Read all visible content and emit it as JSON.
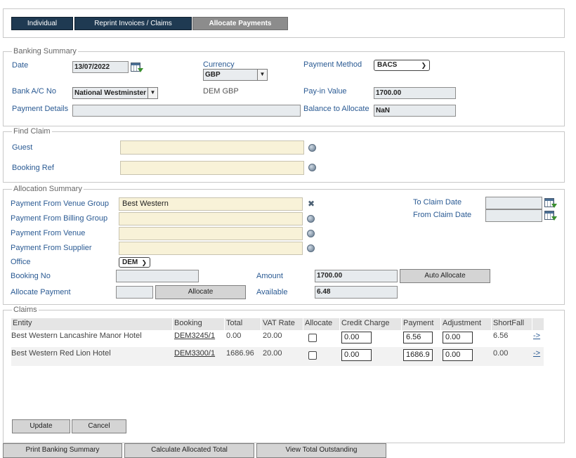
{
  "tabs": [
    {
      "label": "Individual"
    },
    {
      "label": "Reprint Invoices / Claims"
    },
    {
      "label": "Allocate Payments"
    }
  ],
  "banking": {
    "legend": "Banking Summary",
    "date_label": "Date",
    "date_value": "13/07/2022",
    "currency_label": "Currency",
    "currency_value": "GBP",
    "payment_method_label": "Payment Method",
    "payment_method_value": "BACS",
    "bank_label": "Bank A/C No",
    "bank_value": "National Westminster",
    "dem_gbp": "DEM GBP",
    "payin_label": "Pay-in Value",
    "payin_value": "1700.00",
    "payment_details_label": "Payment Details",
    "payment_details_value": "",
    "balance_label": "Balance to Allocate",
    "balance_value": "NaN"
  },
  "find_claim": {
    "legend": "Find Claim",
    "guest_label": "Guest",
    "guest_value": "",
    "booking_ref_label": "Booking Ref",
    "booking_ref_value": ""
  },
  "allocation": {
    "legend": "Allocation Summary",
    "venue_group_label": "Payment From Venue Group",
    "venue_group_value": "Best Western",
    "billing_group_label": "Payment From Billing Group",
    "venue_label": "Payment From Venue",
    "supplier_label": "Payment From Supplier",
    "office_label": "Office",
    "office_value": "DEM",
    "booking_no_label": "Booking No",
    "allocate_payment_label": "Allocate Payment",
    "allocate_button": "Allocate",
    "amount_label": "Amount",
    "amount_value": "1700.00",
    "auto_allocate_button": "Auto Allocate",
    "available_label": "Available",
    "available_value": "6.48",
    "to_claim_label": "To Claim Date",
    "from_claim_label": "From Claim Date"
  },
  "claims": {
    "legend": "Claims",
    "columns": [
      "Entity",
      "Booking",
      "Total",
      "VAT Rate",
      "Allocate",
      "Credit Charge",
      "Payment",
      "Adjustment",
      "ShortFall"
    ],
    "rows": [
      {
        "entity": "Best Western Lancashire Manor Hotel",
        "booking": "DEM3245/1",
        "total": "0.00",
        "vat": "20.00",
        "credit": "0.00",
        "payment": "6.56",
        "adjustment": "0.00",
        "shortfall": "6.56",
        "arrow": "->"
      },
      {
        "entity": "Best Western Red Lion Hotel",
        "booking": "DEM3300/1",
        "total": "1686.96",
        "vat": "20.00",
        "credit": "0.00",
        "payment": "1686.9",
        "adjustment": "0.00",
        "shortfall": "0.00",
        "arrow": "->"
      }
    ],
    "update_button": "Update",
    "cancel_button": "Cancel"
  },
  "footer": {
    "print_button": "Print Banking Summary",
    "calculate_button": "Calculate Allocated Total",
    "outstanding_button": "View Total Outstanding"
  },
  "colors": {
    "tab_dark": "#1f3a52",
    "tab_active": "#8c8c8c",
    "label_blue": "#2a5a93",
    "field_yellow": "#f8f2d8"
  }
}
